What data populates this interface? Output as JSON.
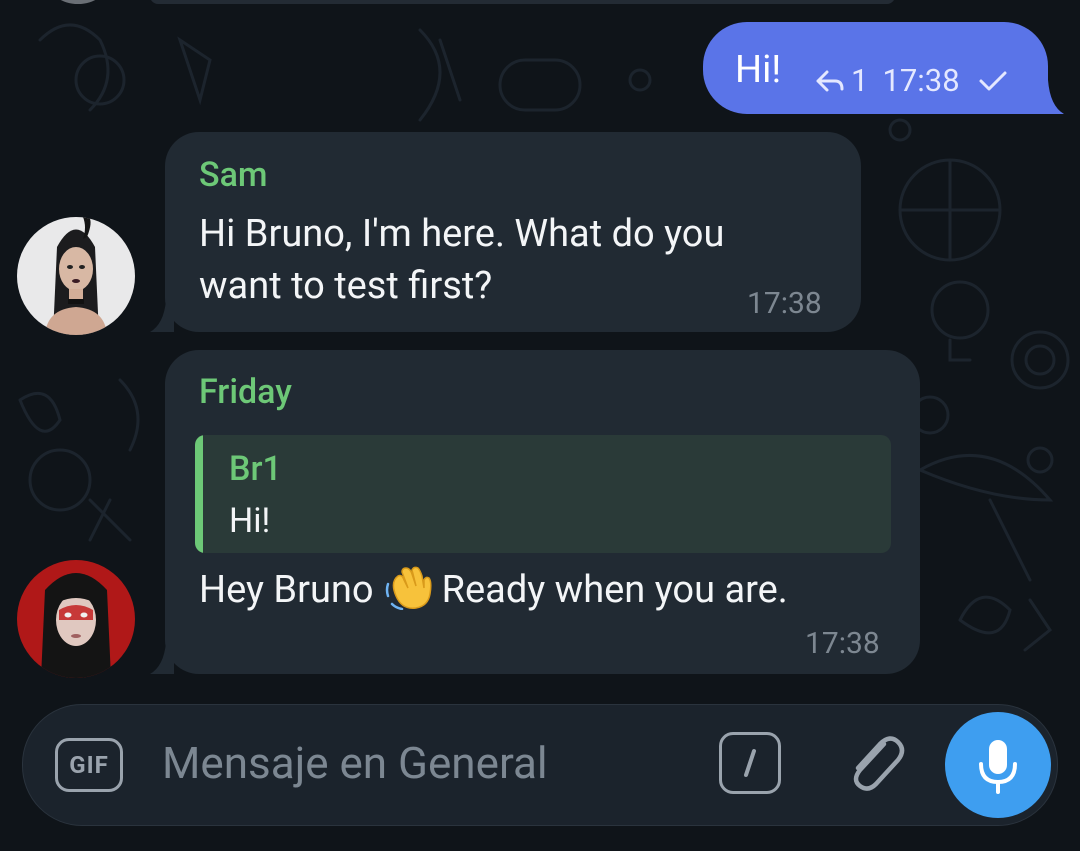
{
  "outgoing": {
    "text": "Hi!",
    "reply_count": "1",
    "time": "17:38",
    "status_icon": "check-icon"
  },
  "messages": [
    {
      "sender": "Sam",
      "text_lines": [
        "Hi Bruno, I'm here. What do you",
        "want to test first?"
      ],
      "time": "17:38",
      "avatar": "avatar-woman-dark-hair"
    },
    {
      "sender": "Friday",
      "reply_to": {
        "name": "Br1",
        "text": "Hi!"
      },
      "text_before_emoji": "Hey Bruno",
      "emoji": "waving-hand",
      "text_after_emoji": "Ready when you are.",
      "time": "17:38",
      "avatar": "avatar-woman-red-eyes"
    }
  ],
  "input": {
    "gif_label": "GIF",
    "placeholder": "Mensaje en General"
  },
  "colors": {
    "background": "#0f1419",
    "outgoing_bubble": "#5a74e8",
    "incoming_bubble": "#212a33",
    "sender_name": "#6dc877",
    "mic_button": "#3e9ef0"
  }
}
